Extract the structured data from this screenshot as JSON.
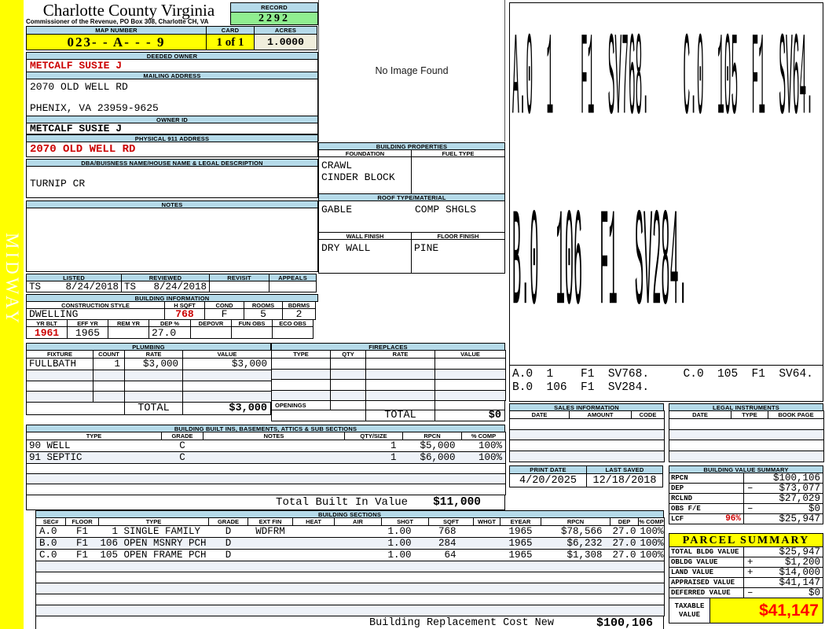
{
  "colors": {
    "header_bar_blue": "#B5DAE9",
    "highlight_yellow": "#FFFF00",
    "record_green": "#90EE90",
    "acres_cream": "#F0EEDC",
    "alert_red": "#CC0000",
    "taxable_red": "#FF0000",
    "row_shade": "#EEF2F8"
  },
  "strip": {
    "text": "MIDWAY"
  },
  "header": {
    "county": "Charlotte County Virginia",
    "commissioner": "Commissioner of the Revenue, PO Box 308, Charlotte CH, VA",
    "record_label": "RECORD",
    "record_value": "2292",
    "map_number_label": "MAP NUMBER",
    "map_number": "023- - A- - - 9",
    "card_label": "CARD",
    "card_value": "1 of 1",
    "acres_label": "ACRES",
    "acres_value": "1.0000"
  },
  "owner": {
    "deeded_label": "DEEDED OWNER",
    "deeded": "METCALF SUSIE J",
    "mailing_label": "MAILING ADDRESS",
    "mail1": "2070 OLD WELL RD",
    "mail2": "PHENIX, VA 23959-9625",
    "owner_id_label": "OWNER ID",
    "owner_id": "METCALF SUSIE J",
    "physical_label": "PHYSICAL 911 ADDRESS",
    "physical": "2070 OLD WELL RD",
    "dba_label": "DBA/BUISNESS NAME/HOUSE NAME & LEGAL DESCRIPTION",
    "dba": "TURNIP CR",
    "notes_label": "NOTES",
    "notes": ""
  },
  "review": {
    "listed_label": "LISTED",
    "reviewed_label": "REVIEWED",
    "revisit_label": "REVISIT",
    "appeals_label": "APPEALS",
    "listed_by": "TS",
    "listed_date": "8/24/2018",
    "reviewed_by": "TS",
    "reviewed_date": "8/24/2018",
    "revisit": "",
    "appeals": ""
  },
  "binfo": {
    "title": "BUILDING INFORMATION",
    "h1": [
      "CONSTRUCTION STYLE",
      "H SQFT",
      "COND",
      "ROOMS",
      "BDRMS"
    ],
    "style": "DWELLING",
    "hsqft": "768",
    "cond": "F",
    "rooms": "5",
    "bdrms": "2",
    "h2": [
      "YR BLT",
      "EFF YR",
      "REM YR",
      "DEP %",
      "DEPOVR",
      "FUN OBS",
      "ECO OBS"
    ],
    "yr_blt": "1961",
    "eff_yr": "1965",
    "rem_yr": "",
    "dep_pct": "27.0",
    "depovr": "",
    "fun_obs": "",
    "eco_obs": ""
  },
  "plumbing": {
    "title": "PLUMBING",
    "headers": [
      "FIXTURE",
      "COUNT",
      "RATE",
      "VALUE"
    ],
    "rows": [
      [
        "FULLBATH",
        "1",
        "$3,000",
        "$3,000"
      ],
      [
        "",
        "",
        "",
        ""
      ],
      [
        "",
        "",
        "",
        ""
      ],
      [
        "",
        "",
        "",
        ""
      ]
    ],
    "total_label": "TOTAL",
    "total_value": "$3,000"
  },
  "fireplaces": {
    "title": "FIREPLACES",
    "headers": [
      "TYPE",
      "QTY",
      "RATE",
      "VALUE"
    ],
    "rows": [
      [
        "",
        "",
        "",
        ""
      ],
      [
        "",
        "",
        "",
        ""
      ],
      [
        "",
        "",
        "",
        ""
      ],
      [
        "",
        "",
        "",
        ""
      ]
    ],
    "openings_label": "OPENINGS",
    "total_label": "TOTAL",
    "total_value": "$0"
  },
  "built_ins": {
    "title": "BUILDING BUILT INS, BASEMENTS, ATTICS & SUB SECTIONS",
    "headers": [
      "TYPE",
      "GRADE",
      "NOTES",
      "QTY/SIZE",
      "RPCN",
      "% COMP"
    ],
    "rows": [
      [
        "90 WELL",
        "C",
        "",
        "1",
        "$5,000",
        "100%"
      ],
      [
        "91 SEPTIC",
        "C",
        "",
        "1",
        "$6,000",
        "100%"
      ],
      [
        "",
        "",
        "",
        "",
        "",
        ""
      ],
      [
        "",
        "",
        "",
        "",
        "",
        ""
      ],
      [
        "",
        "",
        "",
        "",
        "",
        ""
      ]
    ],
    "total_label": "Total Built In Value",
    "total_value": "$11,000"
  },
  "image_panel": {
    "message": "No Image Found"
  },
  "properties": {
    "title": "BUILDING PROPERTIES",
    "foundation_label": "FOUNDATION",
    "fuel_label": "FUEL TYPE",
    "foundation1": "CRAWL",
    "foundation2": "CINDER BLOCK",
    "fuel": "",
    "roof_label": "ROOF TYPE/MATERIAL",
    "roof_type": "GABLE",
    "roof_material": "COMP SHGLS",
    "wall_label": "WALL FINISH",
    "floor_label": "FLOOR FINISH",
    "wall": "DRY WALL",
    "floor": "PINE"
  },
  "sketch": {
    "line1": "A.0  1    F1  SV768.     C.0  105  F1  SV64.",
    "line2": "B.0  106  F1  SV284."
  },
  "sales": {
    "title": "SALES INFORMATION",
    "headers": [
      "DATE",
      "AMOUNT",
      "CODE"
    ],
    "rows": [
      [
        "",
        "",
        ""
      ],
      [
        "",
        "",
        ""
      ],
      [
        "",
        "",
        ""
      ],
      [
        "",
        "",
        ""
      ]
    ]
  },
  "legal": {
    "title": "LEGAL INSTRUMENTS",
    "headers": [
      "DATE",
      "TYPE",
      "BOOK PAGE"
    ],
    "rows": [
      [
        "",
        "",
        ""
      ],
      [
        "",
        "",
        ""
      ],
      [
        "",
        "",
        ""
      ],
      [
        "",
        "",
        ""
      ]
    ]
  },
  "print_info": {
    "print_date_label": "PRINT DATE",
    "print_date": "4/20/2025",
    "last_saved_label": "LAST SAVED",
    "last_saved": "12/18/2018"
  },
  "bvs": {
    "title": "BUILDING VALUE SUMMARY",
    "rows": [
      {
        "label": "RPCN",
        "pct": "",
        "op": "",
        "value": "$100,106"
      },
      {
        "label": "DEP",
        "pct": "",
        "op": "–",
        "value": "$73,077"
      },
      {
        "label": "RCLND",
        "pct": "",
        "op": "",
        "value": "$27,029"
      },
      {
        "label": "OBS F/E",
        "pct": "",
        "op": "–",
        "value": "$0"
      },
      {
        "label": "LCF",
        "pct": "96%",
        "op": "",
        "value": "$25,947"
      }
    ]
  },
  "sections": {
    "title": "BUILDING SECTIONS",
    "headers": [
      "SEC#",
      "FLOOR",
      "TYPE",
      "GRADE",
      "EXT FIN",
      "HEAT",
      "AIR",
      "SHGT",
      "SQFT",
      "WHGT",
      "EYEAR",
      "RPCN",
      "DEP",
      "% COMP"
    ],
    "rows": [
      [
        "A.0",
        "F1",
        "  1 SINGLE FAMILY",
        "D",
        "WDFRM",
        "",
        "",
        "1.00",
        "768",
        "",
        "1965",
        "$78,566",
        "27.0",
        "100%"
      ],
      [
        "B.0",
        "F1",
        "106 OPEN MSNRY PCH",
        "D",
        "",
        "",
        "",
        "1.00",
        "284",
        "",
        "1965",
        "$6,232",
        "27.0",
        "100%"
      ],
      [
        "C.0",
        "F1",
        "105 OPEN FRAME PCH",
        "D",
        "",
        "",
        "",
        "1.00",
        "64",
        "",
        "1965",
        "$1,308",
        "27.0",
        "100%"
      ],
      [
        "",
        "",
        "",
        "",
        "",
        "",
        "",
        "",
        "",
        "",
        "",
        "",
        "",
        ""
      ],
      [
        "",
        "",
        "",
        "",
        "",
        "",
        "",
        "",
        "",
        "",
        "",
        "",
        "",
        ""
      ],
      [
        "",
        "",
        "",
        "",
        "",
        "",
        "",
        "",
        "",
        "",
        "",
        "",
        "",
        ""
      ],
      [
        "",
        "",
        "",
        "",
        "",
        "",
        "",
        "",
        "",
        "",
        "",
        "",
        "",
        ""
      ],
      [
        "",
        "",
        "",
        "",
        "",
        "",
        "",
        "",
        "",
        "",
        "",
        "",
        "",
        ""
      ]
    ],
    "footer_label": "Building Replacement Cost New",
    "footer_value": "$100,106"
  },
  "parcel": {
    "title": "PARCEL SUMMARY",
    "rows": [
      {
        "label": "TOTAL BLDG VALUE",
        "op": "",
        "value": "$25,947"
      },
      {
        "label": "OBLDG VALUE",
        "op": "+",
        "value": "$1,200"
      },
      {
        "label": "LAND VALUE",
        "op": "+",
        "value": "$14,000"
      },
      {
        "label": "APPRAISED VALUE",
        "op": "",
        "value": "$41,147"
      },
      {
        "label": "DEFERRED VALUE",
        "op": "–",
        "value": "$0"
      }
    ],
    "taxable_label": "TAXABLE VALUE",
    "taxable_value": "$41,147"
  }
}
